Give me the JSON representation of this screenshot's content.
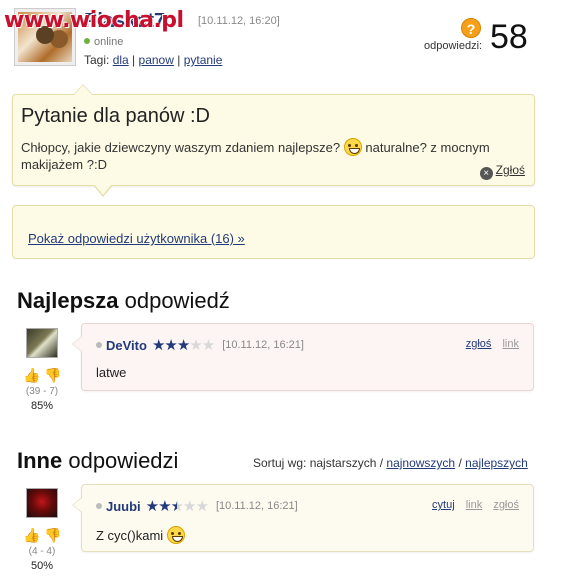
{
  "watermark": "www.wiocha.pl",
  "question": {
    "author": "Plaskat7",
    "date": "[10.11.12, 16:20]",
    "status": "online",
    "tags_label": "Tagi:",
    "tags": [
      "dla",
      "panow",
      "pytanie"
    ],
    "answers_label": "odpowiedzi:",
    "answers_count": "58",
    "title": "Pytanie dla panów :D",
    "body_before": "Chłopcy, jakie dziewczyny waszym zdaniem najlepsze?",
    "body_after": "naturalne? z mocnym makijażem ?:D",
    "report_label": "Zgłoś",
    "show_answers_label": "Pokaż odpowiedzi użytkownika (16) »"
  },
  "best_section": {
    "title_bold": "Najlepsza",
    "title_rest": " odpowiedź"
  },
  "other_section": {
    "title_bold": "Inne",
    "title_rest": " odpowiedzi"
  },
  "sort": {
    "label": "Sortuj wg: najstarszych /",
    "option_newest": "najnowszych",
    "separator": "/",
    "option_best": "najlepszych"
  },
  "answers": [
    {
      "user": "DeVito",
      "stars": 3,
      "date": "[10.11.12, 16:21]",
      "links": [
        "zgłoś",
        "link"
      ],
      "text": "latwe",
      "votes": "(39 - 7)",
      "percent": "85%"
    },
    {
      "user": "Juubi",
      "stars": 2.5,
      "date": "[10.11.12, 16:21]",
      "links": [
        "cytuj",
        "link",
        "zgłoś"
      ],
      "text": "Z cyc()kami",
      "votes": "(4 - 4)",
      "percent": "50%"
    }
  ],
  "colors": {
    "link": "#233a7a",
    "question_bg": "#fdfbe5",
    "best_bg": "#fdf5f3",
    "accent_orange": "#f5a018"
  },
  "icons": {
    "question": "question-icon",
    "report": "close-circle-icon",
    "vote_up": "thumbs-up-icon",
    "vote_down": "thumbs-down-icon",
    "rating": "star-icon",
    "emoticon": "smiley-icon"
  }
}
